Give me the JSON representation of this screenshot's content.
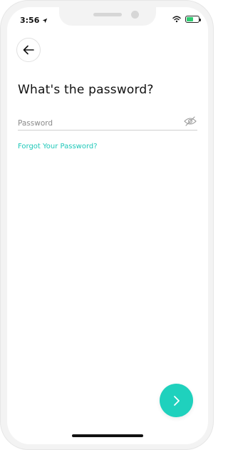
{
  "status_bar": {
    "time": "3:56",
    "battery_level": 0.55
  },
  "page": {
    "title": "What's the password?"
  },
  "password": {
    "value": "",
    "placeholder": "Password"
  },
  "forgot_link": "Forgot Your Password?",
  "colors": {
    "accent": "#1fd1bd",
    "link": "#1ec8b9",
    "text": "#111111"
  },
  "icons": {
    "back": "arrow-left-icon",
    "visibility": "eye-slash-icon",
    "next": "chevron-right-icon"
  }
}
